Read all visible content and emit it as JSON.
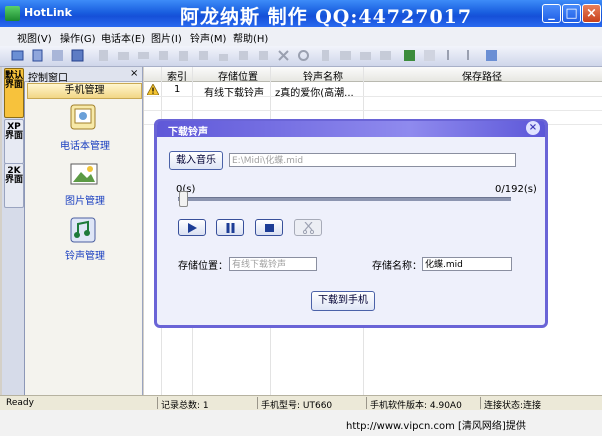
{
  "window": {
    "title": "HotLink",
    "banner": "阿龙纳斯 制作 QQ:44727017"
  },
  "menu": [
    "视图(V)",
    "操作(G)",
    "电话本(E)",
    "图片(I)",
    "铃声(M)",
    "帮助(H)"
  ],
  "left_panel": {
    "title": "控制窗口",
    "close": "×",
    "subheader": "手机管理",
    "vertical_tabs": [
      "默认界面",
      "XP界面",
      "2K界面"
    ],
    "nav": [
      {
        "label": "电话本管理",
        "icon": "phonebook-icon"
      },
      {
        "label": "图片管理",
        "icon": "picture-icon"
      },
      {
        "label": "铃声管理",
        "icon": "ringtone-icon"
      }
    ]
  },
  "table": {
    "columns": [
      "",
      "索引",
      "存储位置",
      "铃声名称",
      "保存路径"
    ],
    "rows": [
      {
        "index": "1",
        "location": "有线下载铃声",
        "name": "z真的爱你(高潮...",
        "path": ""
      }
    ]
  },
  "dialog": {
    "title": "下载铃声",
    "load_button": "载入音乐",
    "file_path": "E:\\Midi\\化蝶.mid",
    "time_current": "0(s)",
    "time_total": "0/192(s)",
    "progress": 0,
    "location_label": "存储位置：",
    "location_value": "有线下载铃声",
    "name_label": "存储名称：",
    "name_value": "化蝶.mid",
    "download_button": "下载到手机"
  },
  "status": {
    "ready": "Ready",
    "record_count": "记录总数: 1",
    "phone_model": "手机型号: UT660",
    "firmware": "手机软件版本: 4.90A0",
    "connection": "连接状态:连接"
  },
  "watermark": "http://www.vipcn.com [清风网络]提供",
  "colors": {
    "titlebar": "#1a5fe0",
    "dialog_border": "#6a64d6",
    "accent_yellow": "#f7c23c"
  }
}
